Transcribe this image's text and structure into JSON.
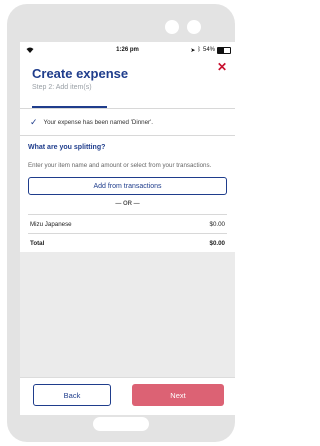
{
  "status_bar": {
    "time": "1:26 pm",
    "battery": "54%"
  },
  "header": {
    "title": "Create expense",
    "step": "Step 2: Add item(s)",
    "close_icon": "close-icon",
    "progress": 0.33
  },
  "notice": {
    "text": "Your expense has been named 'Dinner'."
  },
  "split": {
    "question": "What are you splitting?",
    "description": "Enter your item name and amount or select from your transactions.",
    "add_button": "Add from transactions",
    "or_label": "— OR —"
  },
  "items": [
    {
      "name": "Mizu Japanese",
      "amount": "$0.00"
    }
  ],
  "total": {
    "label": "Total",
    "amount": "$0.00"
  },
  "footer": {
    "back": "Back",
    "next": "Next"
  },
  "colors": {
    "primary": "#1f3d8c",
    "accent": "#c8102e",
    "next_button": "#dc6274"
  }
}
